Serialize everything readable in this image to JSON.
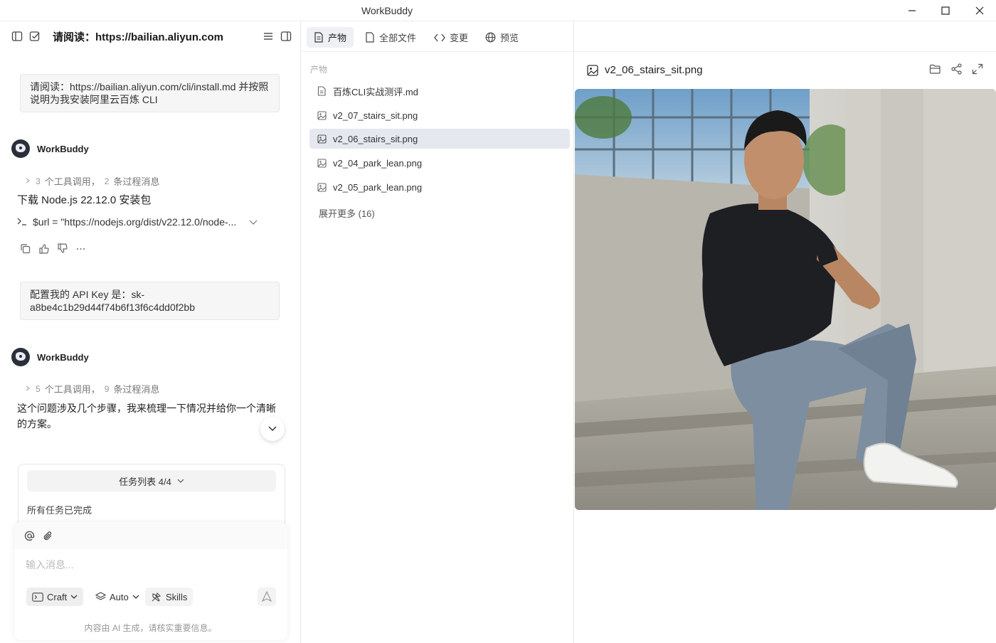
{
  "window": {
    "title": "WorkBuddy"
  },
  "left": {
    "header_title": "请阅读：https://bailian.aliyun.com",
    "user_msg_1": "请阅读：https://bailian.aliyun.com/cli/install.md 并按照说明为我安装阿里云百炼 CLI",
    "bot_name": "WorkBuddy",
    "proc_1": {
      "tool_count": "3",
      "tool_label": "个工具调用，",
      "msg_count": "2",
      "msg_label": "条过程消息"
    },
    "bot_text_1": "下载 Node.js 22.12.0 安装包",
    "cmd_text": "$url = \"https://nodejs.org/dist/v22.12.0/node-...",
    "user_msg_2": "配置我的 API Key 是：sk-a8be4c1b29d44f74b6f13f6c4dd0f2bb",
    "proc_2": {
      "tool_count": "5",
      "tool_label": "个工具调用，",
      "msg_count": "9",
      "msg_label": "条过程消息"
    },
    "bot_text_2": "这个问题涉及几个步骤，我来梳理一下情况并给你一个清晰的方案。",
    "task_list_label": "任务列表 4/4",
    "task_done": "所有任务已完成",
    "input_placeholder": "输入消息...",
    "mode_label": "Craft",
    "model_label": "Auto",
    "skills_label": "Skills",
    "disclaimer": "内容由 AI 生成，请核实重要信息。"
  },
  "tabs": [
    {
      "label": "产物",
      "icon": "document-icon",
      "active": true
    },
    {
      "label": "全部文件",
      "icon": "file-icon",
      "active": false
    },
    {
      "label": "变更",
      "icon": "code-icon",
      "active": false
    },
    {
      "label": "预览",
      "icon": "globe-icon",
      "active": false
    }
  ],
  "files": {
    "section_label": "产物",
    "items": [
      {
        "name": "百炼CLI实战测评.md",
        "icon": "document-icon"
      },
      {
        "name": "v2_07_stairs_sit.png",
        "icon": "image-icon"
      },
      {
        "name": "v2_06_stairs_sit.png",
        "icon": "image-icon",
        "selected": true
      },
      {
        "name": "v2_04_park_lean.png",
        "icon": "image-icon"
      },
      {
        "name": "v2_05_park_lean.png",
        "icon": "image-icon"
      }
    ],
    "more_label": "展开更多 (16)"
  },
  "preview": {
    "file_name": "v2_06_stairs_sit.png"
  }
}
